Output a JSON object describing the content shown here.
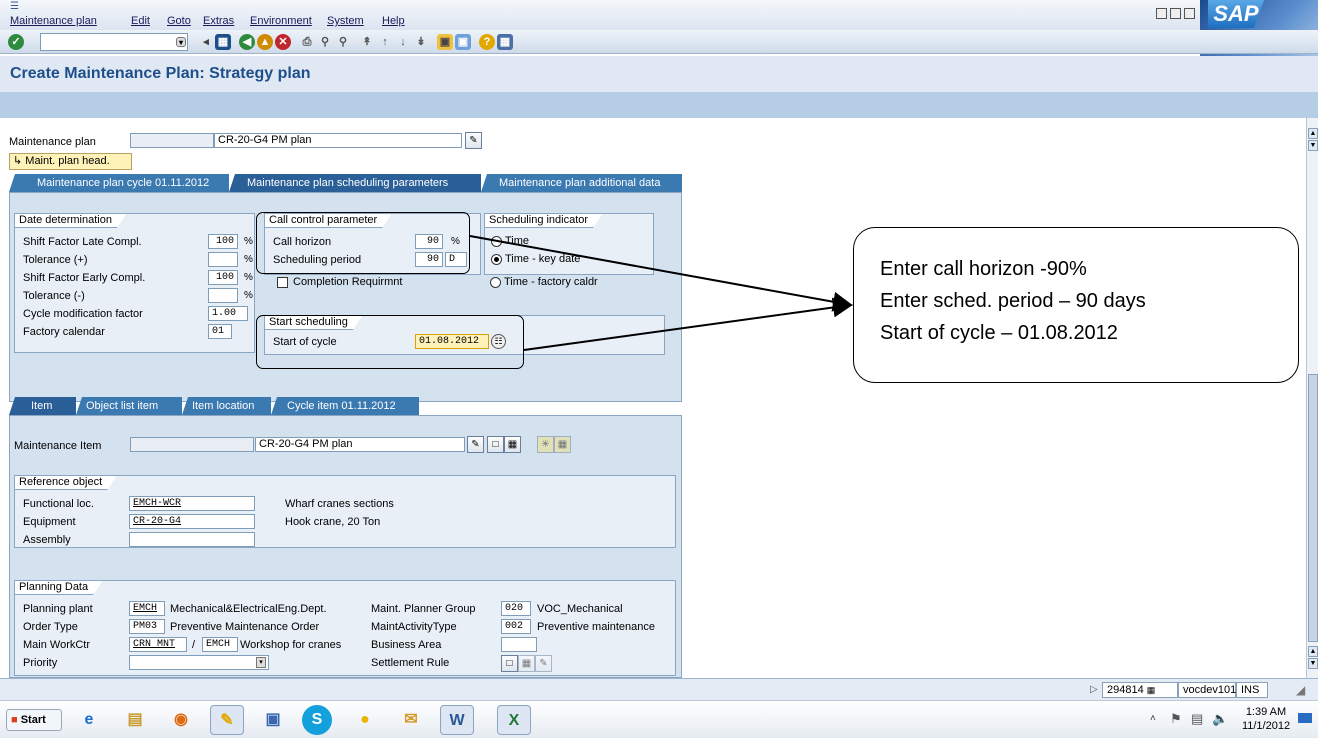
{
  "menu": [
    "Maintenance plan",
    "Edit",
    "Goto",
    "Extras",
    "Environment",
    "System",
    "Help"
  ],
  "title": "Create Maintenance Plan: Strategy plan",
  "header": {
    "maintenance_plan_label": "Maintenance plan",
    "maintenance_plan_value": "CR-20-G4 PM plan",
    "maint_plan_head_button": "Maint. plan head."
  },
  "top_tabs": [
    "Maintenance plan cycle 01.11.2012",
    "Maintenance plan scheduling parameters",
    "Maintenance plan additional data"
  ],
  "date_determination": {
    "title": "Date determination",
    "rows": [
      {
        "label": "Shift Factor Late Compl.",
        "value": "100",
        "unit": "%"
      },
      {
        "label": "Tolerance (+)",
        "value": "",
        "unit": "%"
      },
      {
        "label": "Shift Factor Early Compl.",
        "value": "100",
        "unit": "%"
      },
      {
        "label": "Tolerance (-)",
        "value": "",
        "unit": "%"
      },
      {
        "label": "Cycle modification factor",
        "value": "1.00",
        "unit": ""
      },
      {
        "label": "Factory calendar",
        "value": "01",
        "unit": ""
      }
    ]
  },
  "call_control": {
    "title": "Call control parameter",
    "call_horizon_label": "Call horizon",
    "call_horizon_value": "90",
    "call_horizon_unit": "%",
    "scheduling_period_label": "Scheduling period",
    "scheduling_period_value": "90",
    "scheduling_period_unit": "D",
    "completion_label": "Completion Requirmnt"
  },
  "scheduling_indicator": {
    "title": "Scheduling indicator",
    "options": [
      "Time",
      "Time - key date",
      "Time - factory caldr"
    ],
    "selected": "Time - key date"
  },
  "start_scheduling": {
    "title": "Start scheduling",
    "start_of_cycle_label": "Start of cycle",
    "start_of_cycle_value": "01.08.2012"
  },
  "bottom_tabs": [
    "Item",
    "Object list item",
    "Item location",
    "Cycle item 01.11.2012"
  ],
  "item": {
    "maintenance_item_label": "Maintenance Item",
    "maintenance_item_value": "CR-20-G4 PM plan"
  },
  "reference_object": {
    "title": "Reference object",
    "functional_loc_label": "Functional loc.",
    "functional_loc_value": "EMCH-WCR",
    "functional_loc_desc": "Wharf cranes sections",
    "equipment_label": "Equipment",
    "equipment_value": "CR-20-G4",
    "equipment_desc": "Hook crane, 20 Ton",
    "assembly_label": "Assembly",
    "assembly_value": ""
  },
  "planning_data": {
    "title": "Planning Data",
    "planning_plant_label": "Planning plant",
    "planning_plant_value": "EMCH",
    "planning_plant_desc": "Mechanical&ElectricalEng.Dept.",
    "order_type_label": "Order Type",
    "order_type_value": "PM03",
    "order_type_desc": "Preventive Maintenance Order",
    "main_workctr_label": "Main WorkCtr",
    "main_workctr_value": "CRN MNT",
    "main_workctr_sep": "/",
    "main_workctr_plant": "EMCH",
    "main_workctr_desc": "Workshop for cranes",
    "priority_label": "Priority",
    "planner_group_label": "Maint. Planner Group",
    "planner_group_value": "020",
    "planner_group_desc": "VOC_Mechanical",
    "activity_type_label": "MaintActivityType",
    "activity_type_value": "002",
    "activity_type_desc": "Preventive maintenance",
    "business_area_label": "Business Area",
    "settlement_rule_label": "Settlement Rule"
  },
  "status": {
    "session": "294814",
    "server": "vocdev101",
    "mode": "INS"
  },
  "taskbar": {
    "start_label": "Start",
    "time": "1:39 AM",
    "date": "11/1/2012"
  },
  "callout": {
    "lines": [
      "Enter call horizon -90%",
      "Enter sched. period – 90 days",
      "Start of cycle – 01.08.2012"
    ]
  },
  "logo_text": "SAP",
  "colors": {
    "title_blue": "#1f4f8a",
    "tab_active": "#2a5f97",
    "panel_bg": "#d4e2f0",
    "highlight_yellow": "#fff2b8"
  }
}
